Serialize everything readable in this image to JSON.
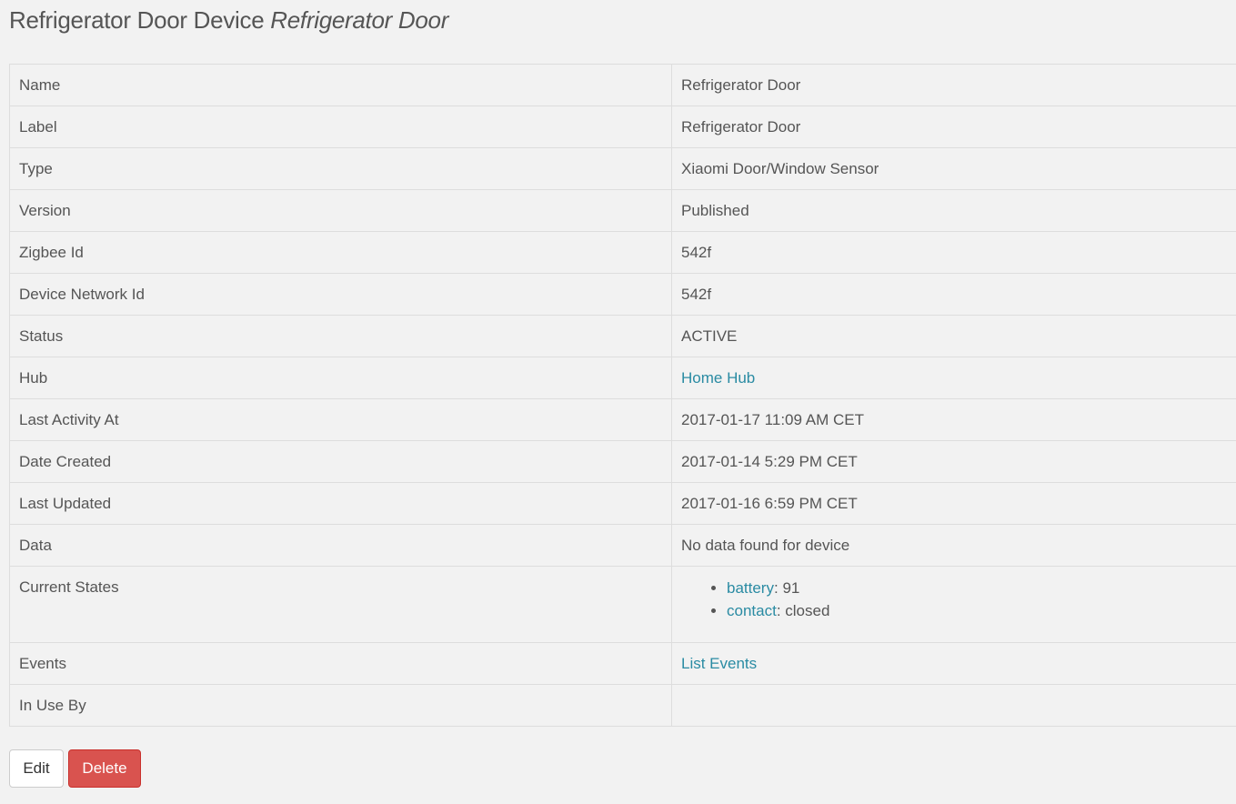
{
  "header": {
    "title": "Refrigerator Door Device",
    "subtitle": "Refrigerator Door"
  },
  "properties": [
    {
      "key": "Name",
      "value": "Refrigerator Door"
    },
    {
      "key": "Label",
      "value": "Refrigerator Door"
    },
    {
      "key": "Type",
      "value": "Xiaomi Door/Window Sensor"
    },
    {
      "key": "Version",
      "value": "Published"
    },
    {
      "key": "Zigbee Id",
      "value": "542f"
    },
    {
      "key": "Device Network Id",
      "value": "542f"
    },
    {
      "key": "Status",
      "value": "ACTIVE"
    },
    {
      "key": "Hub",
      "value": "Home Hub"
    },
    {
      "key": "Last Activity At",
      "value": "2017-01-17 11:09 AM CET"
    },
    {
      "key": "Date Created",
      "value": "2017-01-14 5:29 PM CET"
    },
    {
      "key": "Last Updated",
      "value": "2017-01-16 6:59 PM CET"
    },
    {
      "key": "Data",
      "value": "No data found for device"
    },
    {
      "key": "Current States",
      "value": ""
    },
    {
      "key": "Events",
      "value": "List Events"
    },
    {
      "key": "In Use By",
      "value": ""
    }
  ],
  "current_states": [
    {
      "name": "battery",
      "value": "91"
    },
    {
      "name": "contact",
      "value": "closed"
    }
  ],
  "actions": {
    "edit_label": "Edit",
    "delete_label": "Delete"
  },
  "colors": {
    "link": "#2a8ba3",
    "danger": "#d9534f",
    "text": "#555555",
    "background": "#f2f2f2"
  }
}
